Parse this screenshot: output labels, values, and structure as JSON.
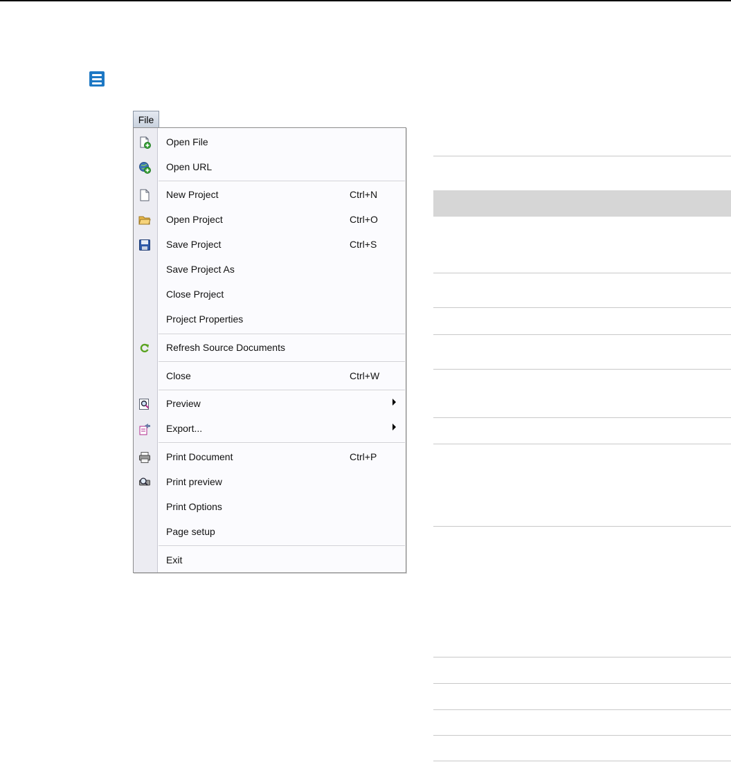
{
  "app_menu": {
    "icon": "hamburger-menu-icon"
  },
  "file_tab": {
    "label": "File"
  },
  "menu": {
    "open_file": {
      "label": "Open File",
      "icon": "open-file-icon"
    },
    "open_url": {
      "label": "Open URL",
      "icon": "open-url-icon"
    },
    "new_project": {
      "label": "New Project",
      "shortcut": "Ctrl+N",
      "icon": "new-document-icon"
    },
    "open_project": {
      "label": "Open Project",
      "shortcut": "Ctrl+O",
      "icon": "open-folder-icon"
    },
    "save_project": {
      "label": "Save Project",
      "shortcut": "Ctrl+S",
      "icon": "floppy-disk-icon"
    },
    "save_project_as": {
      "label": "Save Project As"
    },
    "close_project": {
      "label": "Close Project"
    },
    "project_properties": {
      "label": "Project Properties"
    },
    "refresh": {
      "label": "Refresh Source Documents",
      "icon": "refresh-icon"
    },
    "close": {
      "label": "Close",
      "shortcut": "Ctrl+W"
    },
    "preview": {
      "label": "Preview",
      "icon": "magnifier-icon",
      "has_submenu": true
    },
    "export": {
      "label": "Export...",
      "icon": "export-icon",
      "has_submenu": true
    },
    "print_document": {
      "label": "Print Document",
      "shortcut": "Ctrl+P",
      "icon": "printer-icon"
    },
    "print_preview": {
      "label": "Print preview",
      "icon": "print-preview-icon"
    },
    "print_options": {
      "label": "Print Options"
    },
    "page_setup": {
      "label": "Page setup"
    },
    "exit": {
      "label": "Exit"
    }
  },
  "colors": {
    "accent": "#1d78c4",
    "menu_background": "#fbfbfe",
    "gutter": "#ececf2",
    "highlight_row": "#d6d6d6"
  }
}
